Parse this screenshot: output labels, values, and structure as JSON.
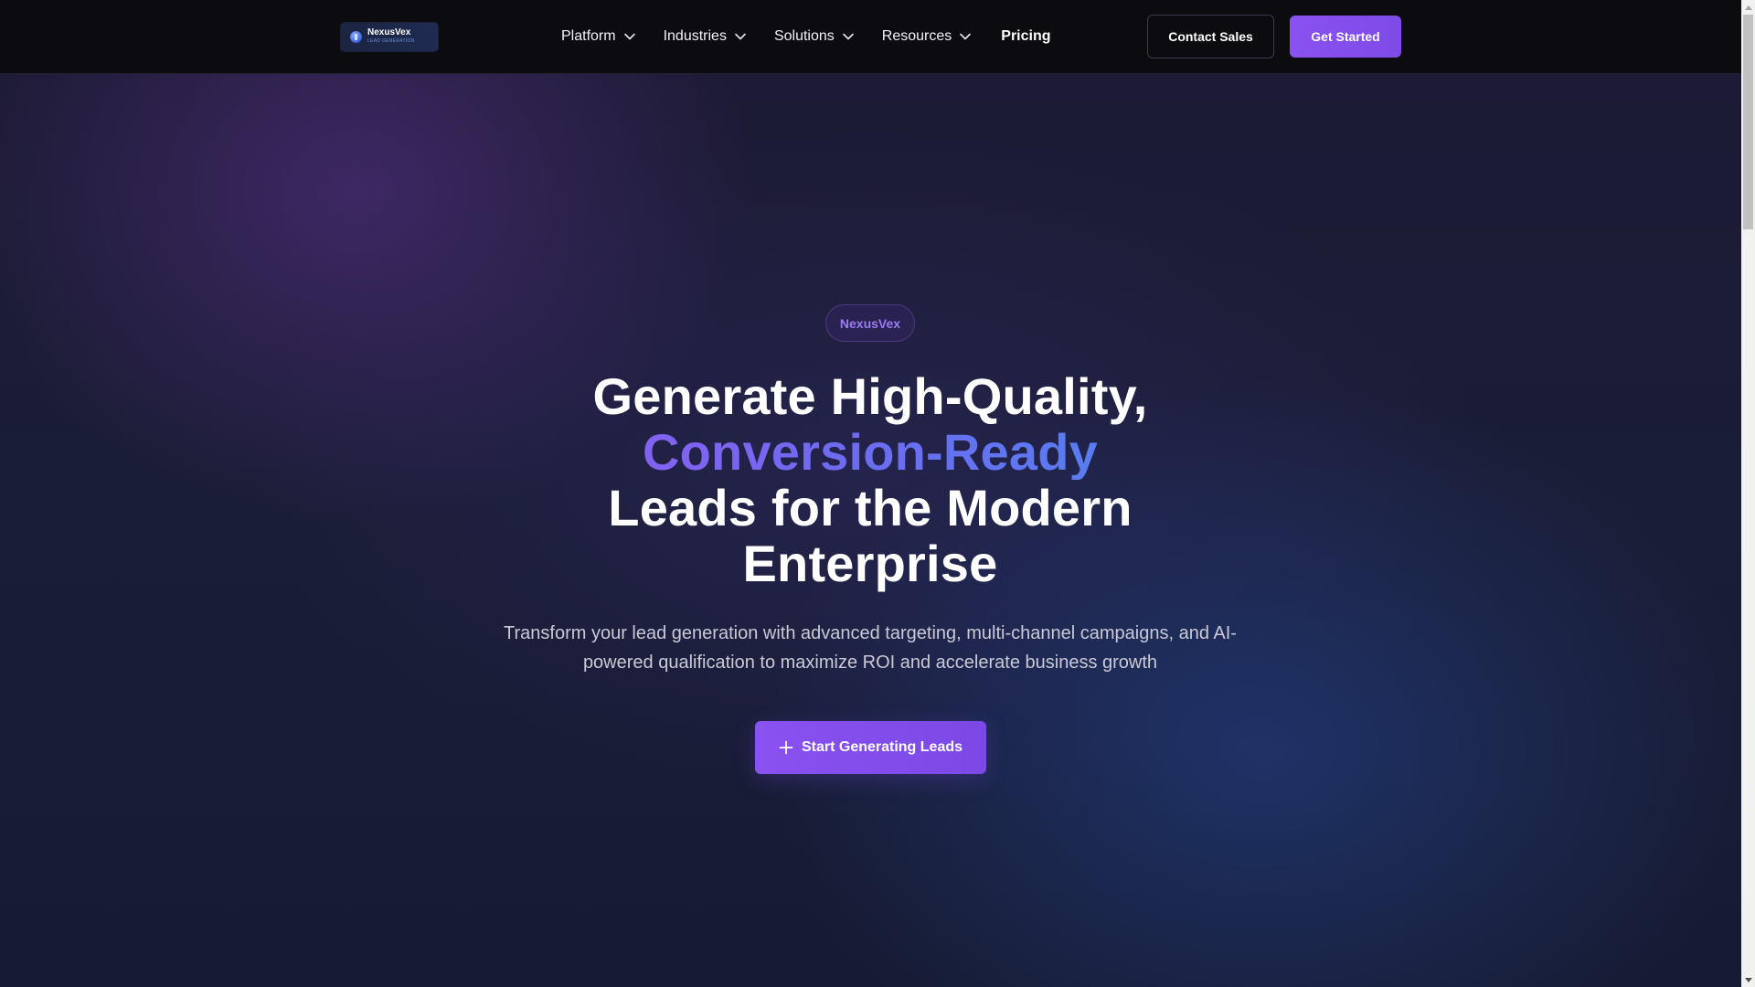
{
  "brand": {
    "name": "NexusVex",
    "tagline": "LEAD GENERATION"
  },
  "nav": {
    "items": [
      {
        "label": "Platform",
        "icon": "chevron-down-icon"
      },
      {
        "label": "Industries",
        "icon": "chevron-down-icon"
      },
      {
        "label": "Solutions",
        "icon": "chevron-down-icon"
      },
      {
        "label": "Resources",
        "icon": "chevron-down-icon"
      },
      {
        "label": "Pricing"
      }
    ],
    "contact_label": "Contact Sales",
    "get_started_label": "Get Started"
  },
  "hero": {
    "badge": "NexusVex",
    "headline_line1": "Generate High-Quality,",
    "headline_highlight": "Conversion-Ready",
    "headline_line3": "Leads for the Modern",
    "headline_line4": "Enterprise",
    "subtitle": "Transform your lead generation with advanced targeting, multi-channel campaigns, and AI-powered qualification to maximize ROI and accelerate business growth",
    "cta_label": "Start Generating Leads",
    "cta_icon": "plus-icon"
  },
  "colors": {
    "accent": "#8a52f0",
    "gradient_start": "#8f5cf0",
    "gradient_end": "#4c86ef",
    "nav_bg": "#0b0b10"
  }
}
